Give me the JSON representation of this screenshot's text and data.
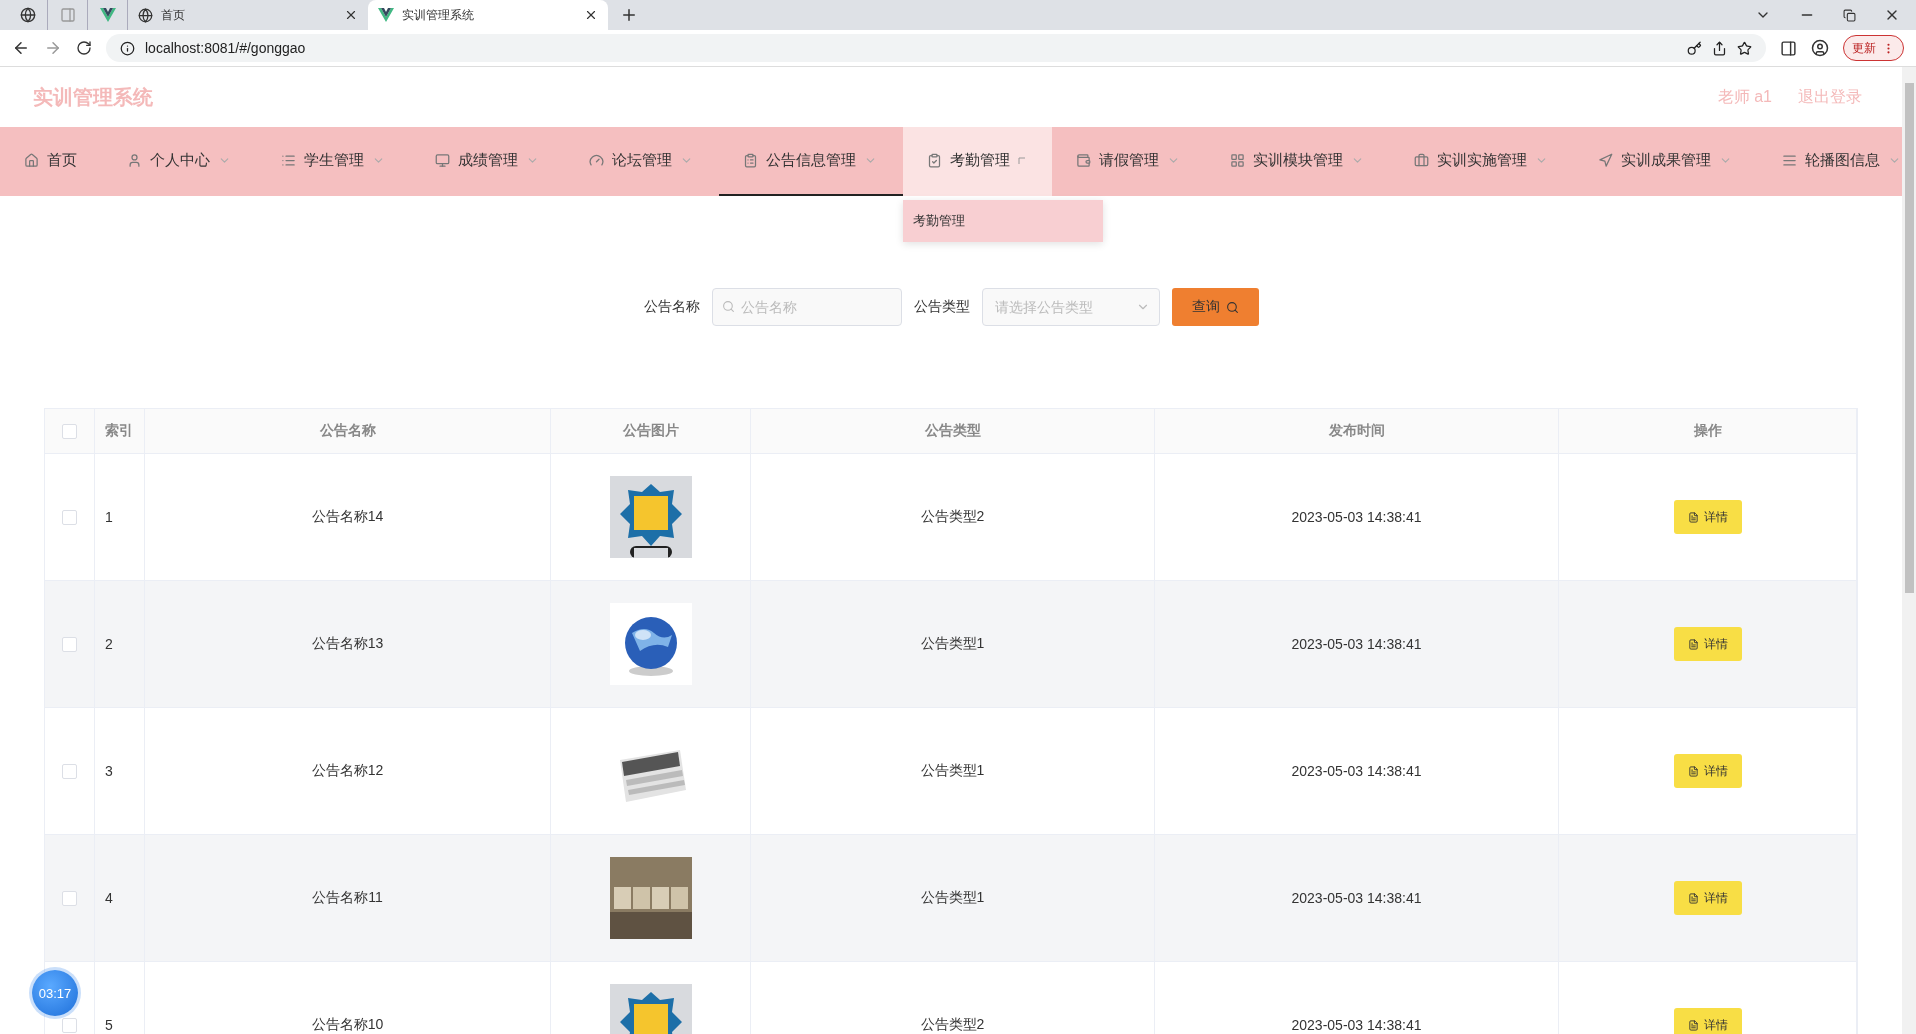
{
  "browser": {
    "tabs": [
      {
        "title": "首页",
        "selected": false
      },
      {
        "title": "实训管理系统",
        "selected": true
      }
    ],
    "address": "localhost:8081/#/gonggao",
    "update_button": "更新"
  },
  "header": {
    "title": "实训管理系统",
    "user": "老师 a1",
    "logout": "退出登录"
  },
  "nav": [
    {
      "label": "首页",
      "dropdown": false,
      "selected": false,
      "expanded": false
    },
    {
      "label": "个人中心",
      "dropdown": true,
      "selected": false,
      "expanded": false
    },
    {
      "label": "学生管理",
      "dropdown": true,
      "selected": false,
      "expanded": false
    },
    {
      "label": "成绩管理",
      "dropdown": true,
      "selected": false,
      "expanded": false
    },
    {
      "label": "论坛管理",
      "dropdown": true,
      "selected": false,
      "expanded": false
    },
    {
      "label": "公告信息管理",
      "dropdown": true,
      "selected": true,
      "expanded": false
    },
    {
      "label": "考勤管理",
      "dropdown": true,
      "selected": false,
      "expanded": true,
      "submenu": [
        "考勤管理"
      ]
    },
    {
      "label": "请假管理",
      "dropdown": true,
      "selected": false,
      "expanded": false
    },
    {
      "label": "实训模块管理",
      "dropdown": true,
      "selected": false,
      "expanded": false
    },
    {
      "label": "实训实施管理",
      "dropdown": true,
      "selected": false,
      "expanded": false
    },
    {
      "label": "实训成果管理",
      "dropdown": true,
      "selected": false,
      "expanded": false
    },
    {
      "label": "轮播图信息",
      "dropdown": true,
      "selected": false,
      "expanded": false
    }
  ],
  "search": {
    "fields": [
      {
        "kind": "text",
        "label": "公告名称",
        "placeholder": "公告名称"
      },
      {
        "kind": "select",
        "label": "公告类型",
        "placeholder": "请选择公告类型"
      }
    ],
    "button": "查询"
  },
  "table": {
    "columns": [
      "索引",
      "公告名称",
      "公告图片",
      "公告类型",
      "发布时间",
      "操作"
    ],
    "all_checked": false,
    "rows": [
      {
        "checked": false,
        "index": "1",
        "name": "公告名称14",
        "type": "公告类型2",
        "time": "2023-05-03 14:38:41",
        "action": "详情"
      },
      {
        "checked": false,
        "index": "2",
        "name": "公告名称13",
        "type": "公告类型1",
        "time": "2023-05-03 14:38:41",
        "action": "详情"
      },
      {
        "checked": false,
        "index": "3",
        "name": "公告名称12",
        "type": "公告类型1",
        "time": "2023-05-03 14:38:41",
        "action": "详情"
      },
      {
        "checked": false,
        "index": "4",
        "name": "公告名称11",
        "type": "公告类型1",
        "time": "2023-05-03 14:38:41",
        "action": "详情"
      },
      {
        "checked": false,
        "index": "5",
        "name": "公告名称10",
        "type": "公告类型2",
        "time": "2023-05-03 14:38:41",
        "action": "详情"
      }
    ]
  },
  "timer": "03:17"
}
